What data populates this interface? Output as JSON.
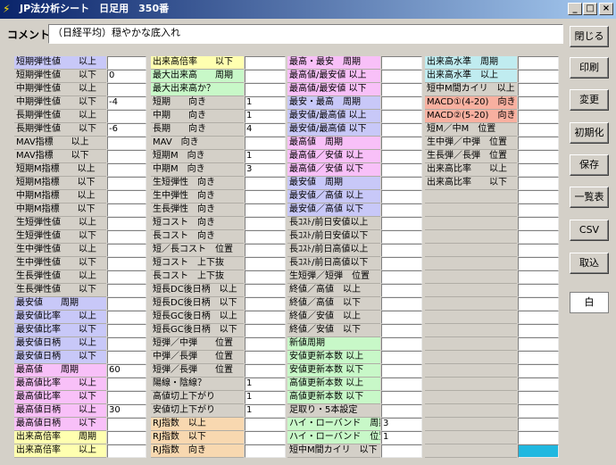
{
  "window": {
    "title": "JP法分析シート　日足用　350番"
  },
  "comment": {
    "label": "コメント",
    "value": "（日経平均）穏やかな底入れ"
  },
  "columns": [
    {
      "rows": [
        {
          "label": "短期弾性値　　以上",
          "value": "",
          "color": "blue"
        },
        {
          "label": "短期弾性値　　以下",
          "value": "0",
          "color": "none"
        },
        {
          "label": "中期弾性値　　以上",
          "value": "",
          "color": "none"
        },
        {
          "label": "中期弾性値　　以下",
          "value": "-4",
          "color": "none"
        },
        {
          "label": "長期弾性値　　以上",
          "value": "",
          "color": "none"
        },
        {
          "label": "長期弾性値　　以下",
          "value": "-6",
          "color": "none"
        },
        {
          "label": "MAV指標　　以上",
          "value": "",
          "color": "none"
        },
        {
          "label": "MAV指標　　以下",
          "value": "",
          "color": "none"
        },
        {
          "label": "短期M指標　　以上",
          "value": "",
          "color": "none"
        },
        {
          "label": "短期M指標　　以下",
          "value": "",
          "color": "none"
        },
        {
          "label": "中期M指標　　以上",
          "value": "",
          "color": "none"
        },
        {
          "label": "中期M指標　　以下",
          "value": "",
          "color": "none"
        },
        {
          "label": "生短弾性値　　以上",
          "value": "",
          "color": "none"
        },
        {
          "label": "生短弾性値　　以下",
          "value": "",
          "color": "none"
        },
        {
          "label": "生中弾性値　　以上",
          "value": "",
          "color": "none"
        },
        {
          "label": "生中弾性値　　以下",
          "value": "",
          "color": "none"
        },
        {
          "label": "生長弾性値　　以上",
          "value": "",
          "color": "none"
        },
        {
          "label": "生長弾性値　　以下",
          "value": "",
          "color": "none"
        },
        {
          "label": "最安値　　周期",
          "value": "",
          "color": "blue"
        },
        {
          "label": "最安値比率　　以上",
          "value": "",
          "color": "blue"
        },
        {
          "label": "最安値比率　　以下",
          "value": "",
          "color": "blue"
        },
        {
          "label": "最安値日柄　　以上",
          "value": "",
          "color": "blue"
        },
        {
          "label": "最安値日柄　　以下",
          "value": "",
          "color": "blue"
        },
        {
          "label": "最高値　　周期",
          "value": "60",
          "color": "pink"
        },
        {
          "label": "最高値比率　　以上",
          "value": "",
          "color": "pink"
        },
        {
          "label": "最高値比率　　以下",
          "value": "",
          "color": "pink"
        },
        {
          "label": "最高値日柄　　以上",
          "value": "30",
          "color": "pink"
        },
        {
          "label": "最高値日柄　　以下",
          "value": "",
          "color": "pink"
        },
        {
          "label": "出来高倍率　　周期",
          "value": "",
          "color": "yellow"
        },
        {
          "label": "出来高倍率　　以上",
          "value": "",
          "color": "yellow"
        }
      ]
    },
    {
      "rows": [
        {
          "label": "出来高倍率　　以下",
          "value": "",
          "color": "yellow"
        },
        {
          "label": "最大出来高　　周期",
          "value": "",
          "color": "green"
        },
        {
          "label": "最大出来高か？",
          "value": "",
          "color": "green"
        },
        {
          "label": "短期　　向き",
          "value": "1",
          "color": "none"
        },
        {
          "label": "中期　　向き",
          "value": "1",
          "color": "none"
        },
        {
          "label": "長期　　向き",
          "value": "4",
          "color": "none"
        },
        {
          "label": "MAV　向き",
          "value": "",
          "color": "none"
        },
        {
          "label": "短期M　向き",
          "value": "1",
          "color": "none"
        },
        {
          "label": "中期M　向き",
          "value": "3",
          "color": "none"
        },
        {
          "label": "生短弾性　向き",
          "value": "",
          "color": "none"
        },
        {
          "label": "生中弾性　向き",
          "value": "",
          "color": "none"
        },
        {
          "label": "生長弾性　向き",
          "value": "",
          "color": "none"
        },
        {
          "label": "短コスト　向き",
          "value": "",
          "color": "none"
        },
        {
          "label": "長コスト　向き",
          "value": "",
          "color": "none"
        },
        {
          "label": "短／長コスト　位置",
          "value": "",
          "color": "none"
        },
        {
          "label": "短コスト　上下抜",
          "value": "",
          "color": "none"
        },
        {
          "label": "長コスト　上下抜",
          "value": "",
          "color": "none"
        },
        {
          "label": "短長DC後日柄　以上",
          "value": "",
          "color": "none"
        },
        {
          "label": "短長DC後日柄　以下",
          "value": "",
          "color": "none"
        },
        {
          "label": "短長GC後日柄　以上",
          "value": "",
          "color": "none"
        },
        {
          "label": "短長GC後日柄　以下",
          "value": "",
          "color": "none"
        },
        {
          "label": "短弾／中弾　　位置",
          "value": "",
          "color": "none"
        },
        {
          "label": "中弾／長弾　　位置",
          "value": "",
          "color": "none"
        },
        {
          "label": "短弾／長弾　　位置",
          "value": "",
          "color": "none"
        },
        {
          "label": "陽線・陰線？",
          "value": "1",
          "color": "none"
        },
        {
          "label": "高値切上下がり",
          "value": "1",
          "color": "none"
        },
        {
          "label": "安値切上下がり",
          "value": "1",
          "color": "none"
        },
        {
          "label": "RJ指数　以上",
          "value": "",
          "color": "orange"
        },
        {
          "label": "RJ指数　以下",
          "value": "",
          "color": "orange"
        },
        {
          "label": "RJ指数　向き",
          "value": "",
          "color": "orange"
        }
      ]
    },
    {
      "rows": [
        {
          "label": "最高・最安　周期",
          "value": "",
          "color": "pink"
        },
        {
          "label": "最高値/最安値 以上",
          "value": "",
          "color": "pink"
        },
        {
          "label": "最高値/最安値 以下",
          "value": "",
          "color": "pink"
        },
        {
          "label": "最安・最高　周期",
          "value": "",
          "color": "blue"
        },
        {
          "label": "最安値/最高値 以上",
          "value": "",
          "color": "blue"
        },
        {
          "label": "最安値/最高値 以下",
          "value": "",
          "color": "blue"
        },
        {
          "label": "最高値　周期",
          "value": "",
          "color": "pink"
        },
        {
          "label": "最高値／安値 以上",
          "value": "",
          "color": "pink"
        },
        {
          "label": "最高値／安値 以下",
          "value": "",
          "color": "pink"
        },
        {
          "label": "最安値　周期",
          "value": "",
          "color": "blue"
        },
        {
          "label": "最安値／高値 以上",
          "value": "",
          "color": "blue"
        },
        {
          "label": "最安値／高値 以下",
          "value": "",
          "color": "blue"
        },
        {
          "label": "長ｺｽﾄ/前日安値以上",
          "value": "",
          "color": "none"
        },
        {
          "label": "長ｺｽﾄ/前日安値以下",
          "value": "",
          "color": "none"
        },
        {
          "label": "長ｺｽﾄ/前日高値以上",
          "value": "",
          "color": "none"
        },
        {
          "label": "長ｺｽﾄ/前日高値以下",
          "value": "",
          "color": "none"
        },
        {
          "label": "生短弾／短弾　位置",
          "value": "",
          "color": "none"
        },
        {
          "label": "終値／高値　以上",
          "value": "",
          "color": "none"
        },
        {
          "label": "終値／高値　以下",
          "value": "",
          "color": "none"
        },
        {
          "label": "終値／安値　以上",
          "value": "",
          "color": "none"
        },
        {
          "label": "終値／安値　以下",
          "value": "",
          "color": "none"
        },
        {
          "label": "新値周期",
          "value": "",
          "color": "green"
        },
        {
          "label": "安値更新本数 以上",
          "value": "",
          "color": "green"
        },
        {
          "label": "安値更新本数 以下",
          "value": "",
          "color": "green"
        },
        {
          "label": "高値更新本数 以上",
          "value": "",
          "color": "green"
        },
        {
          "label": "高値更新本数 以下",
          "value": "",
          "color": "green"
        },
        {
          "label": "足取り・5本設定",
          "value": "",
          "color": "none"
        },
        {
          "label": "ハイ・ローバンド　周期",
          "value": "3",
          "color": "green"
        },
        {
          "label": "ハイ・ローバンド　位置",
          "value": "1",
          "color": "green"
        },
        {
          "label": "短中M間カイリ　以下",
          "value": "",
          "color": "none"
        }
      ]
    },
    {
      "rows": [
        {
          "label": "出来高水準　周期",
          "value": "",
          "color": "cyan"
        },
        {
          "label": "出来高水準　以上",
          "value": "",
          "color": "cyan"
        },
        {
          "label": "短中M間カイリ　以上",
          "value": "",
          "color": "none"
        },
        {
          "label": "MACD①(4-20)　向き",
          "value": "",
          "color": "salmon"
        },
        {
          "label": "MACD②(5-20)　向き",
          "value": "",
          "color": "salmon"
        },
        {
          "label": "短M／中M　位置",
          "value": "",
          "color": "none"
        },
        {
          "label": "生中弾／中弾　位置",
          "value": "",
          "color": "none"
        },
        {
          "label": "生長弾／長弾　位置",
          "value": "",
          "color": "none"
        },
        {
          "label": "出来高比率　　以上",
          "value": "",
          "color": "none"
        },
        {
          "label": "出来高比率　　以下",
          "value": "",
          "color": "none"
        },
        {
          "label": "",
          "value": "",
          "color": "none"
        },
        {
          "label": "",
          "value": "",
          "color": "none"
        },
        {
          "label": "",
          "value": "",
          "color": "none"
        },
        {
          "label": "",
          "value": "",
          "color": "none"
        },
        {
          "label": "",
          "value": "",
          "color": "none"
        },
        {
          "label": "",
          "value": "",
          "color": "none"
        },
        {
          "label": "",
          "value": "",
          "color": "none"
        },
        {
          "label": "",
          "value": "",
          "color": "none"
        },
        {
          "label": "",
          "value": "",
          "color": "none"
        },
        {
          "label": "",
          "value": "",
          "color": "none"
        },
        {
          "label": "",
          "value": "",
          "color": "none"
        },
        {
          "label": "",
          "value": "",
          "color": "none"
        },
        {
          "label": "",
          "value": "",
          "color": "none"
        },
        {
          "label": "",
          "value": "",
          "color": "none"
        },
        {
          "label": "",
          "value": "",
          "color": "none"
        },
        {
          "label": "",
          "value": "",
          "color": "none"
        },
        {
          "label": "",
          "value": "",
          "color": "none"
        },
        {
          "label": "",
          "value": "",
          "color": "none"
        },
        {
          "label": "",
          "value": "",
          "color": "none"
        },
        {
          "label": "",
          "value": "",
          "color": "cyan-selected"
        }
      ]
    }
  ],
  "buttons": [
    {
      "name": "close-button",
      "label": "閉じる"
    },
    {
      "name": "print-button",
      "label": "印刷"
    },
    {
      "name": "change-button",
      "label": "変更"
    },
    {
      "name": "initialize-button",
      "label": "初期化"
    },
    {
      "name": "save-button",
      "label": "保存"
    },
    {
      "name": "list-button",
      "label": "一覧表"
    },
    {
      "name": "csv-button",
      "label": "CSV"
    },
    {
      "name": "import-button",
      "label": "取込"
    },
    {
      "name": "white-button",
      "label": "白"
    }
  ],
  "colors": {
    "blue": "#c8c8f8",
    "yellow": "#ffffb0",
    "green": "#c8f8c8",
    "pink": "#f8c0f8",
    "orange": "#f8d8b0",
    "cyan": "#c0ecf0",
    "salmon": "#f8b0a0",
    "selected": "#20b8e0"
  },
  "window_buttons": {
    "minimize": "_",
    "maximize": "□",
    "close": "×"
  }
}
